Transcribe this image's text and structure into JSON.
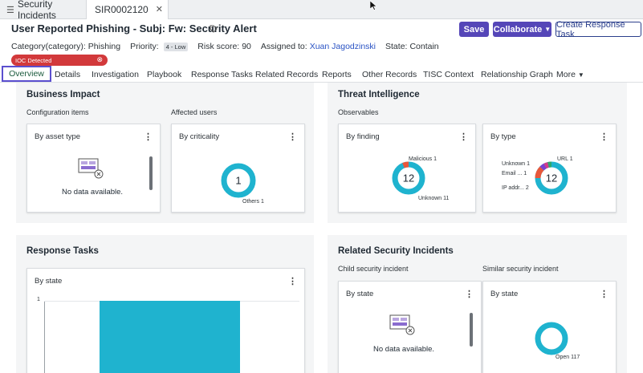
{
  "tabs": {
    "list_tab": "Security Incidents",
    "record_tab": "SIR0002120"
  },
  "header": {
    "title": "User Reported Phishing - Subj: Fw: Security Alert",
    "save_label": "Save",
    "collaborate_label": "Collaborate",
    "create_task_label": "Create Response Task"
  },
  "meta": {
    "category_label": "Category(category):",
    "category_value": "Phishing",
    "priority_label": "Priority:",
    "priority_value": "4 - Low",
    "risk_label": "Risk score:",
    "risk_value": "90",
    "assigned_label": "Assigned to:",
    "assigned_value": "Xuan Jagodzinski",
    "state_label": "State:",
    "state_value": "Contain"
  },
  "ioc_badge": "IOC Detected",
  "nav": {
    "overview": "Overview",
    "details": "Details",
    "investigation": "Investigation",
    "playbook": "Playbook",
    "response_tasks": "Response Tasks",
    "related_records": "Related Records",
    "reports": "Reports",
    "other_records": "Other Records",
    "tisc_context": "TISC Context",
    "relationship_graph": "Relationship Graph",
    "more": "More"
  },
  "business_impact": {
    "title": "Business Impact",
    "config_items": "Configuration items",
    "affected_users": "Affected users",
    "card_asset": {
      "title": "By asset type",
      "nodata": "No data available."
    },
    "card_criticality": {
      "title": "By criticality",
      "center": "1",
      "others_label": "Others",
      "others_value": "1"
    }
  },
  "threat_intel": {
    "title": "Threat Intelligence",
    "observables": "Observables",
    "card_finding": {
      "title": "By finding",
      "center": "12",
      "malicious_label": "Malicious",
      "malicious_value": "1",
      "unknown_label": "Unknown",
      "unknown_value": "11"
    },
    "card_type": {
      "title": "By type",
      "center": "12",
      "unknown_label": "Unknown",
      "unknown_value": "1",
      "email_label": "Email ...",
      "email_value": "1",
      "ip_label": "IP addr...",
      "ip_value": "2",
      "url_label": "URL",
      "url_value": "1"
    }
  },
  "response_tasks": {
    "title": "Response Tasks",
    "card_state": {
      "title": "By state",
      "y_tick": "1"
    }
  },
  "related_incidents": {
    "title": "Related Security Incidents",
    "child": "Child security incident",
    "similar": "Similar security incident",
    "card_child": {
      "title": "By state",
      "nodata": "No data available."
    },
    "card_similar": {
      "title": "By state",
      "open_label": "Open",
      "open_value": "117"
    }
  },
  "colors": {
    "accent": "#5546b8",
    "teal": "#1fb3cf",
    "ioc_red": "#d2393b",
    "link": "#2a53c4"
  }
}
